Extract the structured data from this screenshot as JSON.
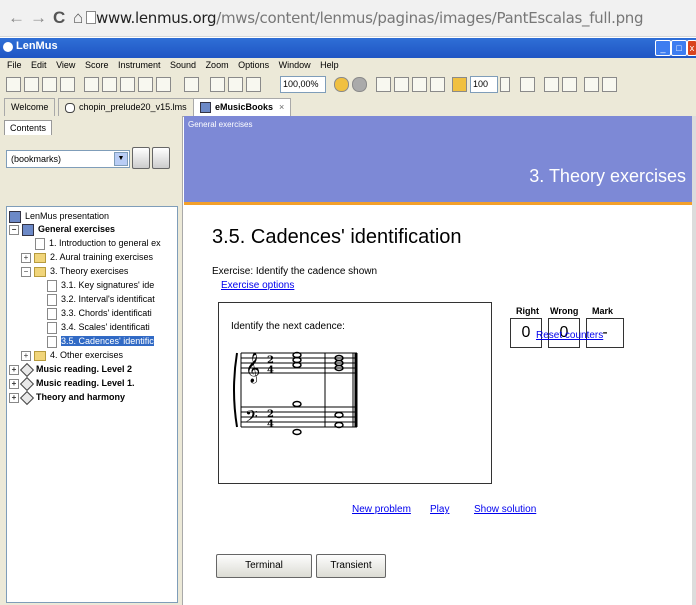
{
  "browser": {
    "url_host": "www.lenmus.org",
    "url_path": "/mws/content/lenmus/paginas/images/PantEscalas_full.png"
  },
  "app": {
    "title": "LenMus",
    "menu": [
      "File",
      "Edit",
      "View",
      "Score",
      "Instrument",
      "Sound",
      "Zoom",
      "Options",
      "Window",
      "Help"
    ],
    "zoom": "100,00%",
    "tempo": "100"
  },
  "tabs": [
    "Welcome",
    "chopin_prelude20_v15.lms",
    "eMusicBooks"
  ],
  "tab_close": "×",
  "left": {
    "tab": "Contents",
    "bookmarks": "(bookmarks)",
    "tree": [
      {
        "label": "LenMus presentation"
      },
      {
        "label": "General exercises"
      },
      {
        "label": "1. Introduction to general ex"
      },
      {
        "label": "2. Aural training exercises"
      },
      {
        "label": "3. Theory exercises"
      },
      {
        "label": "3.1. Key signatures' ide"
      },
      {
        "label": "3.2. Interval's identificat"
      },
      {
        "label": "3.3. Chords' identificati"
      },
      {
        "label": "3.4. Scales' identificati"
      },
      {
        "label": "3.5. Cadences' identific"
      },
      {
        "label": "4. Other exercises"
      },
      {
        "label": "Music reading. Level 2"
      },
      {
        "label": "Music reading. Level 1."
      },
      {
        "label": "Theory and harmony"
      }
    ]
  },
  "main": {
    "banner_small": "General exercises",
    "banner_title": "3. Theory exercises",
    "title": "3.5. Cadences' identification",
    "description": "Exercise: Identify the cadence shown",
    "options_link": "Exercise options",
    "problem_text": "Identify the next cadence:",
    "time_sig_top": "2",
    "time_sig_bottom": "4",
    "headers": {
      "right": "Right",
      "wrong": "Wrong",
      "mark": "Mark"
    },
    "counters": {
      "right": "0",
      "wrong": "0",
      "mark": "-"
    },
    "reset": "Reset counters",
    "actions": {
      "new": "New problem",
      "play": "Play",
      "solution": "Show solution"
    },
    "answers": [
      "Terminal",
      "Transient"
    ]
  }
}
